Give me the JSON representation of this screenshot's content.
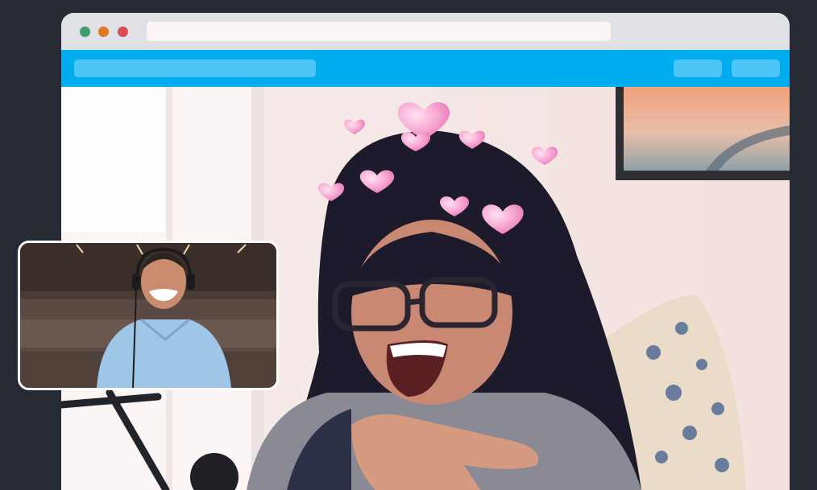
{
  "browser": {
    "address_value": "",
    "traffic_lights": {
      "close": "#dc4a54",
      "minimize": "#df7a21",
      "maximize": "#3d9c6e"
    }
  },
  "toolbar": {
    "background": "#00aeef",
    "meeting_field_text": "",
    "button_one_label": "",
    "button_two_label": ""
  },
  "video_call": {
    "main_feed": "woman-laughing-hearts-filter",
    "self_view": "man-headphones-mouth-filter"
  }
}
